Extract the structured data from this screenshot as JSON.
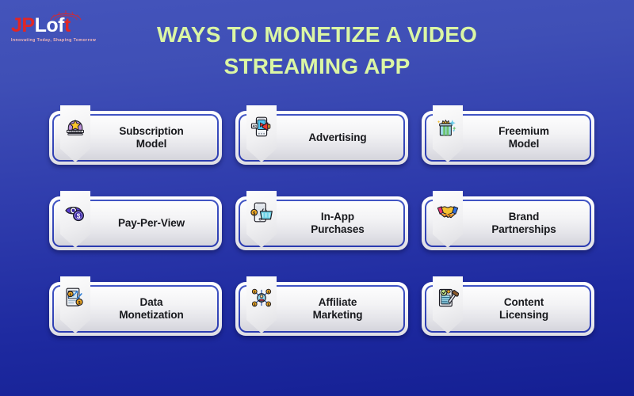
{
  "brand": {
    "name_part1": "JP",
    "name_part2": "L",
    "name_part3": "o",
    "name_part4": "f",
    "name_part5": "t",
    "full_name": "JPLoft",
    "tagline": "Innovating Today, Shaping Tomorrow",
    "logo_red": "#e02626",
    "logo_white": "#ffffff"
  },
  "header": {
    "title_line1": "WAYS TO MONETIZE A VIDEO",
    "title_line2": "STREAMING APP",
    "title_color": "#dbf6a4"
  },
  "theme": {
    "bg_top": "#4454bb",
    "bg_bottom": "#141f93",
    "card_ring": "#2e3fb4",
    "card_face_light": "#fdfdfe",
    "card_face_dark": "#d5d5dc",
    "label_color": "#17181c"
  },
  "cards": [
    {
      "label": "Subscription\nModel",
      "icon": "premium-badge-icon"
    },
    {
      "label": "Advertising",
      "icon": "ad-phone-megaphone-icon"
    },
    {
      "label": "Freemium\nModel",
      "icon": "gift-box-crown-icon"
    },
    {
      "label": "Pay-Per-View",
      "icon": "eye-dollar-coin-icon"
    },
    {
      "label": "In-App\nPurchases",
      "icon": "phone-shopping-basket-icon"
    },
    {
      "label": "Brand\nPartnerships",
      "icon": "handshake-icon"
    },
    {
      "label": "Data\nMonetization",
      "icon": "document-chart-coins-icon"
    },
    {
      "label": "Affiliate\nMarketing",
      "icon": "network-person-coins-icon"
    },
    {
      "label": "Content\nLicensing",
      "icon": "document-gavel-icon"
    }
  ]
}
